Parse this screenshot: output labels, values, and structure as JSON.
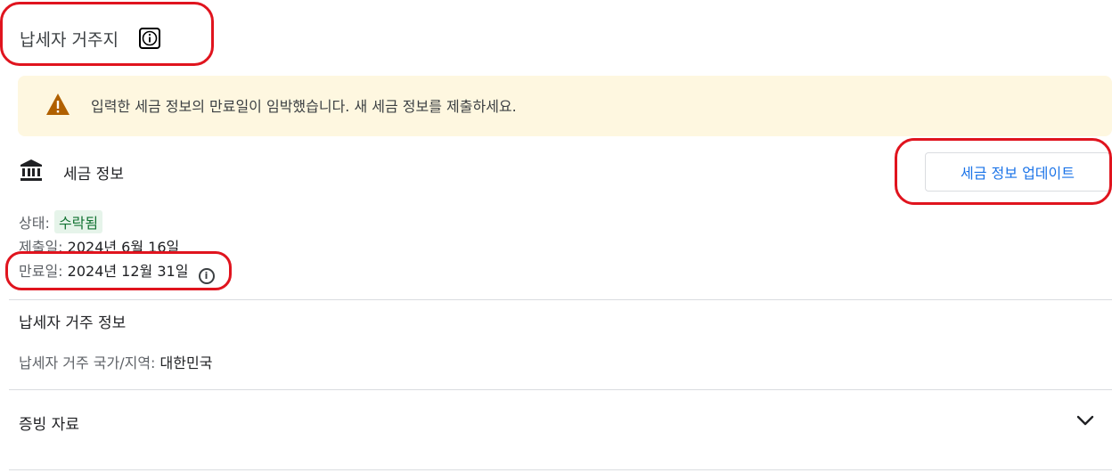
{
  "header": {
    "title": "납세자 거주지"
  },
  "warning": {
    "message": "입력한 세금 정보의 만료일이 임박했습니다. 새 세금 정보를 제출하세요."
  },
  "tax_info": {
    "heading": "세금 정보",
    "update_button": "세금 정보 업데이트",
    "status_label": "상태:",
    "status_value": "수락됨",
    "submitted_label": "제출일:",
    "submitted_value": "2024년 6월 16일",
    "expiry_label": "만료일:",
    "expiry_value": "2024년 12월 31일"
  },
  "residency": {
    "heading": "납세자 거주 정보",
    "country_label": "납세자 거주 국가/지역:",
    "country_value": "대한민국"
  },
  "documents": {
    "heading": "증빙 자료"
  },
  "colors": {
    "accent": "#1a73e8",
    "warning_bg": "#fef7e0",
    "warning_icon": "#b06000",
    "success_bg": "#e6f4ea",
    "success_text": "#137333",
    "annotation": "#e0141e"
  },
  "icons": [
    "info-icon",
    "warning-icon",
    "bank-icon",
    "chevron-down-icon"
  ]
}
